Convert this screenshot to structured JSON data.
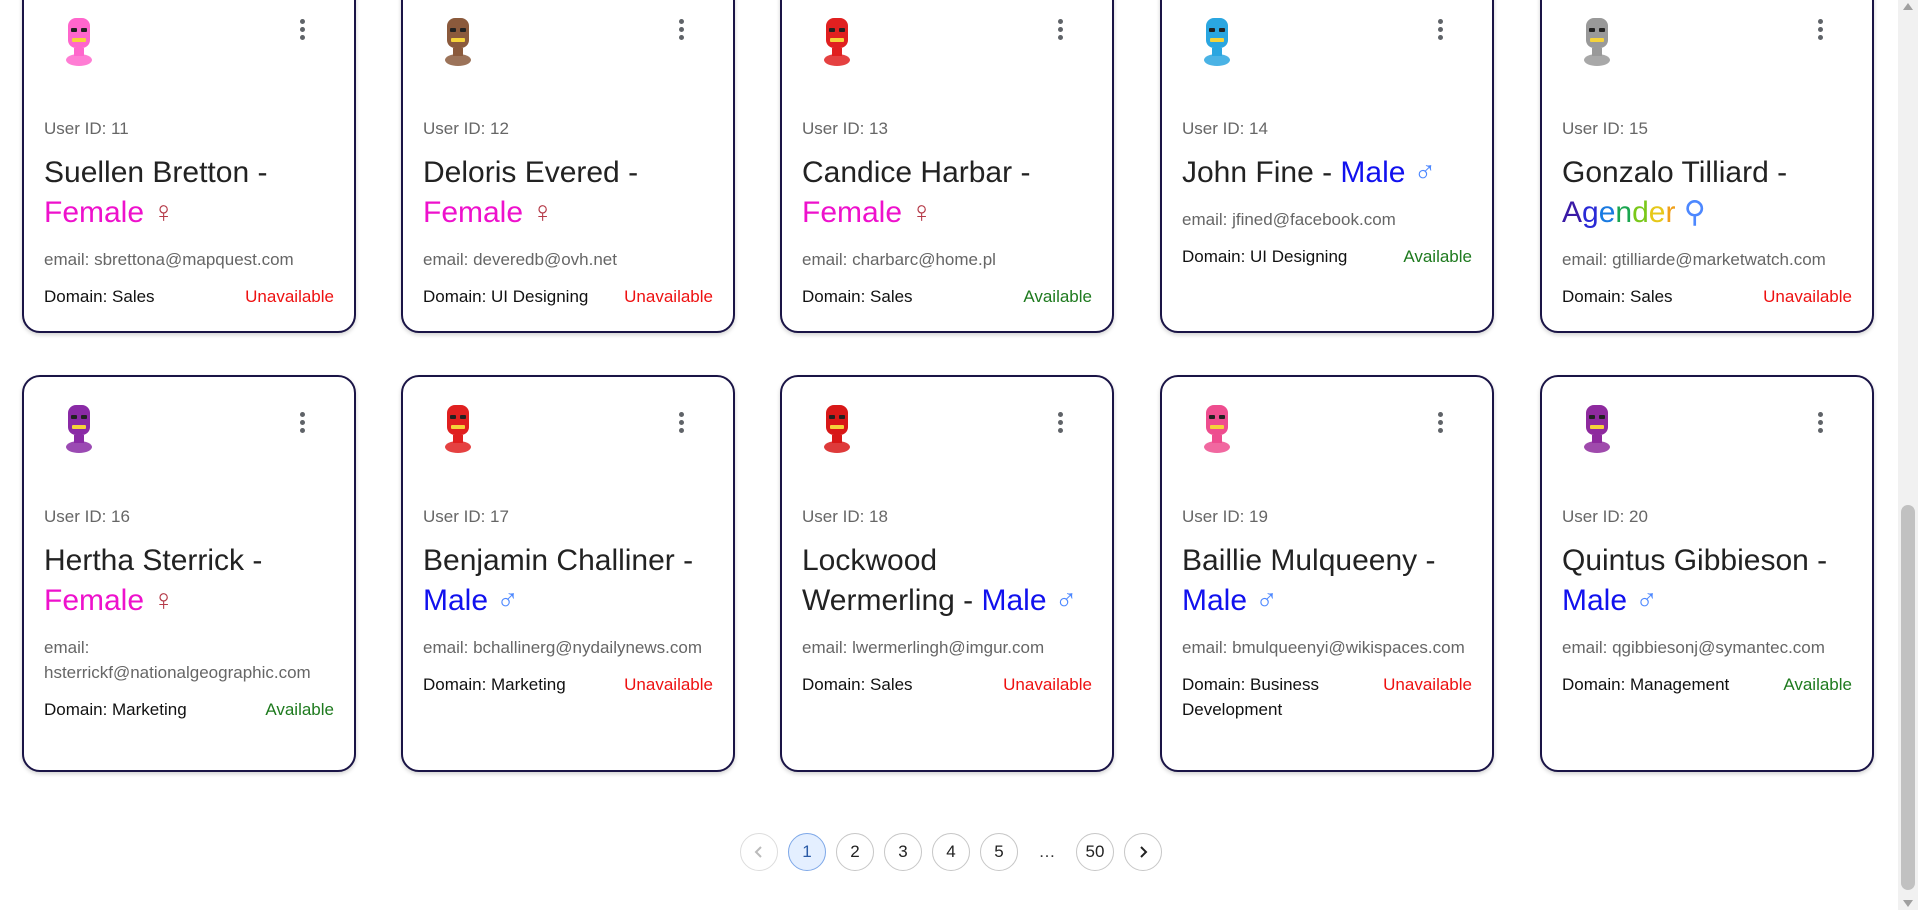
{
  "cards": [
    {
      "user_id": "User ID: 11",
      "name": "Suellen Bretton - ",
      "gender": "Female",
      "gender_class": "female",
      "symbol": "♀",
      "email": "email: sbrettona@mapquest.com",
      "domain": "Domain: Sales",
      "status": "Unavailable",
      "status_class": "un",
      "avatar": "pink-robot",
      "avatar_color": "#ff66cc"
    },
    {
      "user_id": "User ID: 12",
      "name": "Deloris Evered - ",
      "gender": "Female",
      "gender_class": "female",
      "symbol": "♀",
      "email": "email: deveredb@ovh.net",
      "domain": "Domain: UI Designing",
      "status": "Unavailable",
      "status_class": "un",
      "avatar": "brown-robot",
      "avatar_color": "#8b5a3c"
    },
    {
      "user_id": "User ID: 13",
      "name": "Candice Harbar - ",
      "gender": "Female",
      "gender_class": "female",
      "symbol": "♀",
      "email": "email: charbarc@home.pl",
      "domain": "Domain: Sales",
      "status": "Available",
      "status_class": "av",
      "avatar": "red-robot",
      "avatar_color": "#e02020"
    },
    {
      "user_id": "User ID: 14",
      "name": "John Fine - ",
      "gender": "Male",
      "gender_class": "male",
      "symbol": "♂",
      "email": "email: jfined@facebook.com",
      "domain": "Domain: UI Designing",
      "status": "Available",
      "status_class": "av",
      "avatar": "blue-robot",
      "avatar_color": "#2aa6e0"
    },
    {
      "user_id": "User ID: 15",
      "name": "Gonzalo Tilliard - ",
      "gender": "Agender",
      "gender_class": "agender",
      "symbol": "⚲",
      "email": "email: gtilliarde@marketwatch.com",
      "domain": "Domain: Sales",
      "status": "Unavailable",
      "status_class": "un",
      "avatar": "gray-robot",
      "avatar_color": "#999999"
    },
    {
      "user_id": "User ID: 16",
      "name": "Hertha Sterrick - ",
      "gender": "Female",
      "gender_class": "female",
      "symbol": "♀",
      "email": "email: hsterrickf@nationalgeographic.com",
      "domain": "Domain: Marketing",
      "status": "Available",
      "status_class": "av",
      "avatar": "purple-robot",
      "avatar_color": "#8a2aa6"
    },
    {
      "user_id": "User ID: 17",
      "name": "Benjamin Challiner - ",
      "gender": "Male",
      "gender_class": "male",
      "symbol": "♂",
      "email": "email: bchallinerg@nydailynews.com",
      "domain": "Domain: Marketing",
      "status": "Unavailable",
      "status_class": "un",
      "avatar": "red-robot",
      "avatar_color": "#e02020"
    },
    {
      "user_id": "User ID: 18",
      "name": "Lockwood Wermerling - ",
      "gender": "Male",
      "gender_class": "male",
      "symbol": "♂",
      "email": "email: lwermerlingh@imgur.com",
      "domain": "Domain: Sales",
      "status": "Unavailable",
      "status_class": "un",
      "avatar": "red-robot",
      "avatar_color": "#d81818"
    },
    {
      "user_id": "User ID: 19",
      "name": "Baillie Mulqueeny - ",
      "gender": "Male",
      "gender_class": "male",
      "symbol": "♂",
      "email": "email: bmulqueenyi@wikispaces.com",
      "domain": "Domain: Business Development",
      "status": "Unavailable",
      "status_class": "un",
      "avatar": "pink-robot",
      "avatar_color": "#ee4d8f"
    },
    {
      "user_id": "User ID: 20",
      "name": "Quintus Gibbieson - ",
      "gender": "Male",
      "gender_class": "male",
      "symbol": "♂",
      "email": "email: qgibbiesonj@symantec.com",
      "domain": "Domain: Management",
      "status": "Available",
      "status_class": "av",
      "avatar": "purple-robot",
      "avatar_color": "#8e2a9e"
    }
  ],
  "pagination": {
    "prev_icon": "chevron-left-icon",
    "pages": [
      "1",
      "2",
      "3",
      "4",
      "5"
    ],
    "active_page": "1",
    "ellipsis": "…",
    "last_page": "50",
    "next_icon": "chevron-right-icon"
  },
  "colors": {
    "female": "#ee11cc",
    "male": "#1111ee",
    "available": "#1e7a1e",
    "unavailable": "#ee1111",
    "card_border": "#1a1446"
  }
}
